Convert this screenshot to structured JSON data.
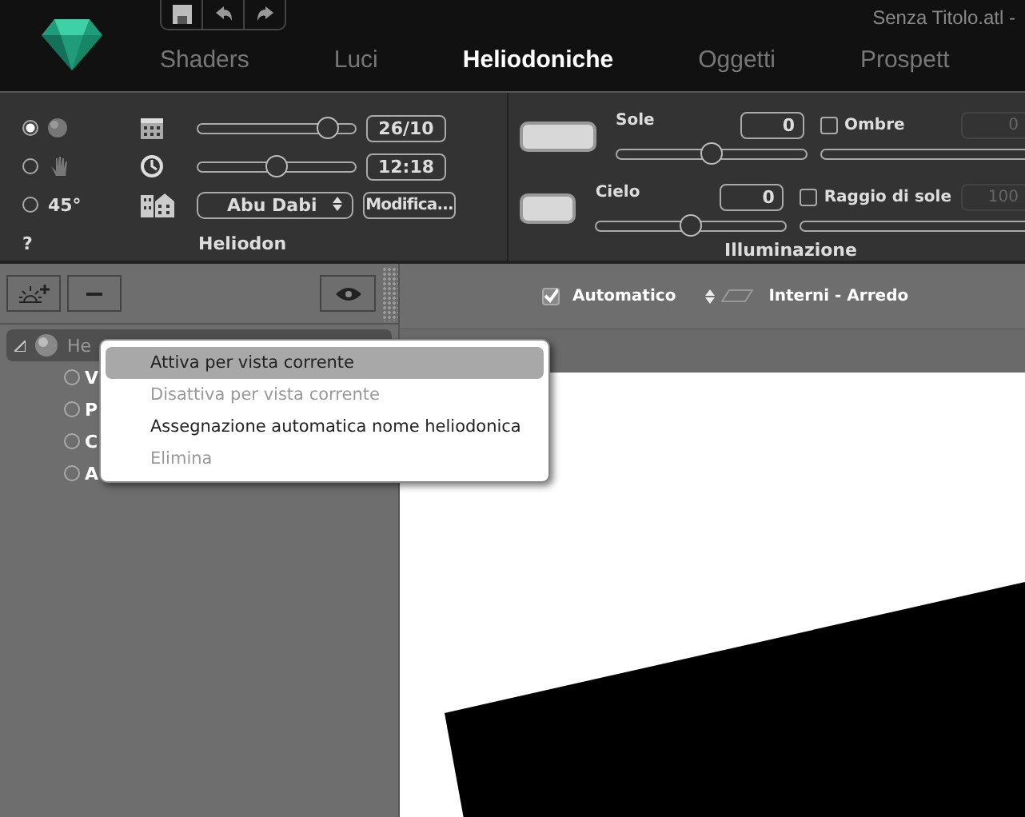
{
  "window": {
    "title": "Senza Titolo.atl -"
  },
  "tabs": [
    {
      "label": "Shaders",
      "selected": false
    },
    {
      "label": "Luci",
      "selected": false
    },
    {
      "label": "Heliodoniche",
      "selected": true
    },
    {
      "label": "Oggetti",
      "selected": false
    },
    {
      "label": "Prospett",
      "selected": false
    }
  ],
  "heliodon": {
    "modes": [
      {
        "kind": "earth",
        "selected": true
      },
      {
        "kind": "hand",
        "selected": false
      },
      {
        "kind": "text",
        "label": "45°",
        "selected": false
      }
    ],
    "date": {
      "level": 0.83,
      "value": "26/10"
    },
    "time": {
      "level": 0.5,
      "value": "12:18"
    },
    "location": "Abu Dabi",
    "edit_button": "Modifica...",
    "help": "?",
    "title": "Heliodon"
  },
  "illuminazione": {
    "rows": [
      {
        "label": "Sole",
        "value": "0",
        "level": 0.5,
        "option": {
          "label": "Ombre",
          "checked": false,
          "value": "0",
          "disabled": true
        }
      },
      {
        "label": "Cielo",
        "value": "0",
        "level": 0.5,
        "option": {
          "label": "Raggio di sole",
          "checked": false,
          "value": "100",
          "disabled": true
        }
      }
    ],
    "title": "Illuminazione"
  },
  "view_toolbar": {
    "automatic": {
      "label": "Automatico",
      "checked": true
    },
    "layer": "Interni - Arredo"
  },
  "tree": [
    {
      "label": "He",
      "expanded": true,
      "selected": true,
      "children": [
        {
          "label": "V",
          "selected": false
        },
        {
          "label": "P",
          "selected": false
        },
        {
          "label": "C",
          "selected": false
        },
        {
          "label": "A",
          "selected": false
        }
      ]
    }
  ],
  "context_menu": [
    {
      "label": "Attiva per vista corrente",
      "disabled": false,
      "selected": true
    },
    {
      "label": "Disattiva per vista corrente",
      "disabled": true,
      "selected": false
    },
    {
      "label": "Assegnazione automatica nome heliodonica",
      "disabled": false,
      "selected": false
    },
    {
      "label": "Elimina",
      "disabled": true,
      "selected": false
    }
  ]
}
